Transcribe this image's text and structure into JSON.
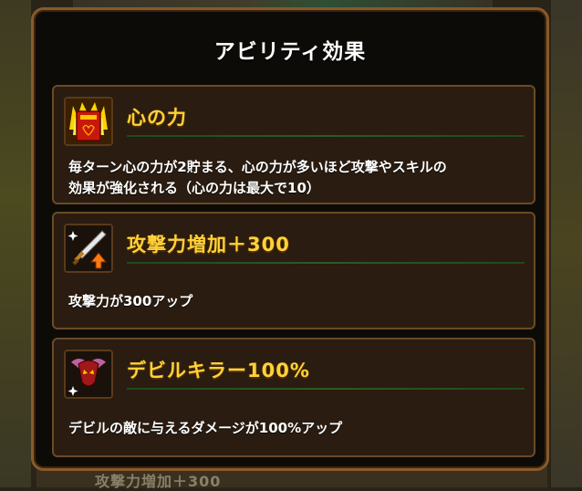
{
  "dialog": {
    "title": "アビリティ効果"
  },
  "abilities": [
    {
      "name": "心の力",
      "icon": "heart-power-icon",
      "description_lines": [
        "毎ターン心の力が2貯まる、心の力が多いほど攻撃やスキルの",
        "効果が強化される（心の力は最大で10）"
      ]
    },
    {
      "name": "攻撃力増加＋300",
      "icon": "sword-attack-up-icon",
      "description_lines": [
        "攻撃力が300アップ"
      ]
    },
    {
      "name": "デビルキラー100%",
      "icon": "devil-killer-icon",
      "description_lines": [
        "デビルの敵に与えるダメージが100%アップ"
      ]
    }
  ],
  "background": {
    "partial_label": "攻撃力増加＋300"
  },
  "colors": {
    "name_text": "#ffd23a",
    "card_bg": "#2a1c10",
    "card_border": "#6b4a26",
    "dialog_border": "#8a5a2a",
    "rule": "#2e5a24"
  }
}
